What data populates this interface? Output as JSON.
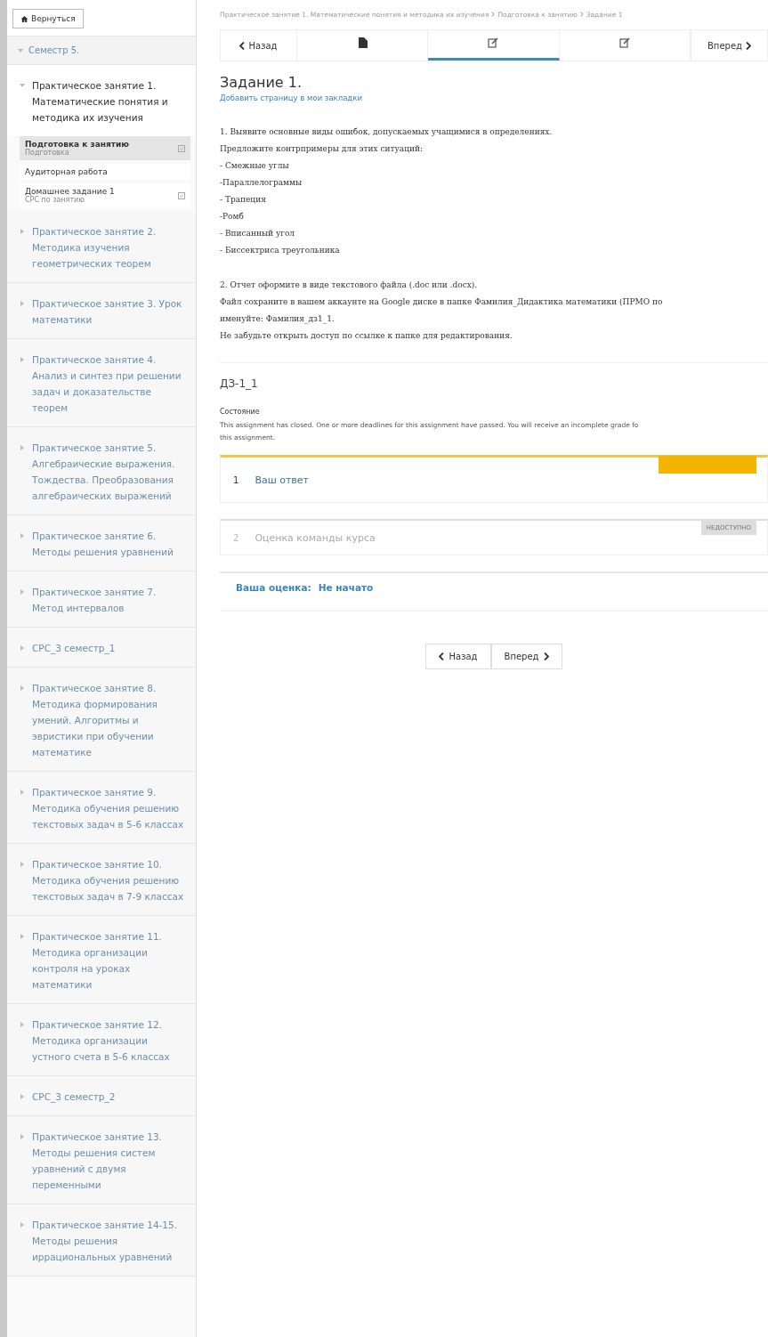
{
  "back_button": {
    "label": "Вернуться"
  },
  "sidebar": {
    "section": {
      "title": "Семестр 5.",
      "expanded": true
    },
    "chapters": [
      {
        "title": "Практическое занятие 1. Математические понятия и методика их изучения",
        "expanded": true,
        "children": [
          {
            "title": "Подготовка к занятию",
            "subtitle": "Подготовка",
            "selected": true,
            "graded": true
          },
          {
            "title": "Аудиторная работа",
            "selected": false,
            "graded": false
          },
          {
            "title": "Домашнее задание 1",
            "subtitle": "СРС по занятию",
            "selected": false,
            "graded": true
          }
        ]
      },
      {
        "title": "Практическое занятие 2. Методика изучения геометрических теорем",
        "expanded": false
      },
      {
        "title": "Практическое занятие 3. Урок математики",
        "expanded": false
      },
      {
        "title": "Практическое занятие 4. Анализ и синтез при решении задач и доказательстве теорем",
        "expanded": false
      },
      {
        "title": "Практическое занятие 5. Алгебраические выражения. Тождества. Преобразования алгебраических выражений",
        "expanded": false
      },
      {
        "title": "Практическое занятие 6. Методы решения уравнений",
        "expanded": false
      },
      {
        "title": "Практическое занятие 7. Метод интервалов",
        "expanded": false
      },
      {
        "title": "СРС_3 семестр_1",
        "expanded": false
      },
      {
        "title": "Практическое занятие 8. Методика формирования умений. Алгоритмы и эвристики при обучении математике",
        "expanded": false
      },
      {
        "title": "Практическое занятие 9. Методика обучения решению текстовых задач в 5-6 классах",
        "expanded": false
      },
      {
        "title": "Практическое занятие 10. Методика обучения решению текстовых задач в 7-9 классах",
        "expanded": false
      },
      {
        "title": "Практическое занятие 11. Методика организации контроля на уроках математики",
        "expanded": false
      },
      {
        "title": "Практическое занятие 12. Методика организации устного счета в 5-6 классах",
        "expanded": false
      },
      {
        "title": "СРС_3 семестр_2",
        "expanded": false
      },
      {
        "title": "Практическое занятие 13. Методы решения систем уравнений с двумя переменными",
        "expanded": false
      },
      {
        "title": "Практическое занятие 14-15. Методы решения иррациональных уравнений",
        "expanded": false
      }
    ]
  },
  "breadcrumb": [
    "Практическое занятие 1. Математические понятия и методика их изучения",
    "Подготовка к занятию",
    "Задание 1"
  ],
  "sequence_nav": {
    "prev": "Назад",
    "next": "Вперед",
    "tabs": [
      {
        "kind": "text",
        "selected": false
      },
      {
        "kind": "problem",
        "selected": true
      },
      {
        "kind": "problem",
        "selected": false
      }
    ]
  },
  "unit": {
    "title": "Задание 1.",
    "bookmark": "Добавить страницу в мои закладки",
    "paragraphs": [
      [
        "1. Выявите основные виды ошибок, допускаемых учащимися в определениях.",
        "Предложите контрпримеры для этих ситуаций:",
        "- Смежные углы",
        "-Параллелограммы",
        "- Трапеция",
        "-Ромб",
        "- Вписанный угол",
        "- Биссектриса треугольника"
      ],
      [
        "2. Отчет оформите в виде текстового файла (.doc или .docx).",
        "Файл сохраните в вашем аккаунте на Google диске в папке Фамилия_Дидактика математики (ПРМО по",
        "именуйте: Фамилия_дз1_1.",
        "Не забудьте открыть доступ по ссылке к папке для редактирования."
      ]
    ]
  },
  "assignment": {
    "title": "ДЗ-1_1",
    "status_label": "Состояние",
    "status": "This assignment has closed. One or more deadlines for this assignment have passed. You will receive an incomplete grade fo",
    "status_end": "this assignment.",
    "steps": [
      {
        "number": "1",
        "title": "Ваш ответ",
        "active": true
      },
      {
        "number": "2",
        "title": "Оценка команды курса",
        "active": false,
        "badge": "НЕДОСТУПНО"
      }
    ],
    "grade_label": "Ваша оценка:",
    "grade_value": "Не начато"
  },
  "bottom_nav": {
    "prev": "Назад",
    "next": "Вперед"
  }
}
